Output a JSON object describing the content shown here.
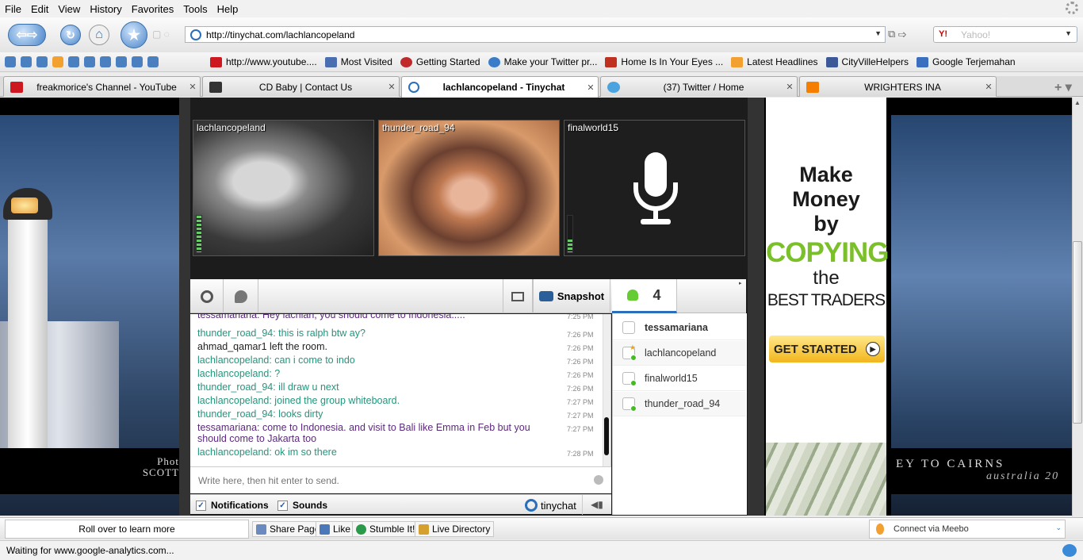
{
  "menu": [
    "File",
    "Edit",
    "View",
    "History",
    "Favorites",
    "Tools",
    "Help"
  ],
  "address": {
    "url": "http://tinychat.com/lachlancopeland",
    "search_placeholder": "Yahoo!"
  },
  "bookmarks": [
    {
      "label": "http://www.youtube....",
      "color": "#cc181e"
    },
    {
      "label": "Most Visited",
      "color": "#4a6fb0"
    },
    {
      "label": "Getting Started",
      "color": "#c0282a"
    },
    {
      "label": "Make your Twitter pr...",
      "color": "#3b7cc8"
    },
    {
      "label": "Home Is In Your Eyes ...",
      "color": "#c03020"
    },
    {
      "label": "Latest Headlines",
      "color": "#f2a030"
    },
    {
      "label": "CityVilleHelpers",
      "color": "#3b5998"
    },
    {
      "label": "Google Terjemahan",
      "color": "#3a6fc0"
    }
  ],
  "tabs": [
    {
      "label": "freakmorice's Channel - YouTube",
      "icon": "youtube-icon",
      "color": "#cc181e"
    },
    {
      "label": "CD Baby | Contact Us",
      "icon": "cdbaby-icon",
      "color": "#333333"
    },
    {
      "label": "lachlancopeland - Tinychat",
      "icon": "tinychat-icon",
      "color": "#2a6fba"
    },
    {
      "label": "(37) Twitter / Home",
      "icon": "twitter-icon",
      "color": "#4aa3df"
    },
    {
      "label": "WRIGHTERS INA",
      "icon": "blogger-icon",
      "color": "#f57d00"
    }
  ],
  "videos": [
    {
      "name": "lachlancopeland"
    },
    {
      "name": "thunder_road_94"
    },
    {
      "name": "finalworld15"
    }
  ],
  "toolbar": {
    "snapshot_label": "Snapshot",
    "user_count": "4"
  },
  "messages": [
    {
      "text": "tessamariana: Hey lachlan, you should come to Indonesia.....",
      "time": "7:25 PM",
      "color": "purple"
    },
    {
      "text": "thunder_road_94: this is ralph btw ay?",
      "time": "7:26 PM",
      "color": "green"
    },
    {
      "text": "ahmad_qamar1 left the room.",
      "time": "7:26 PM",
      "color": "black"
    },
    {
      "text": "lachlancopeland: can i come to indo",
      "time": "7:26 PM",
      "color": "green"
    },
    {
      "text": "lachlancopeland: ?",
      "time": "7:26 PM",
      "color": "green"
    },
    {
      "text": "thunder_road_94: ill draw u next",
      "time": "7:26 PM",
      "color": "green"
    },
    {
      "text": "lachlancopeland: joined the group whiteboard.",
      "time": "7:27 PM",
      "color": "green"
    },
    {
      "text": "thunder_road_94: looks dirty",
      "time": "7:27 PM",
      "color": "green"
    },
    {
      "text": "tessamariana: come to Indonesia. and visit to Bali like Emma in Feb but you should come to Jakarta too",
      "time": "7:27 PM",
      "color": "purple"
    },
    {
      "text": "lachlancopeland: ok im so there",
      "time": "7:28 PM",
      "color": "green"
    }
  ],
  "chat_input": {
    "placeholder": "Write here, then hit enter to send."
  },
  "chat_footer": {
    "notifications": "Notifications",
    "sounds": "Sounds",
    "brand": "tinychat"
  },
  "users": [
    {
      "name": "tessamariana",
      "status": "none"
    },
    {
      "name": "lachlancopeland",
      "status": "owner"
    },
    {
      "name": "finalworld15",
      "status": "online"
    },
    {
      "name": "thunder_road_94",
      "status": "online"
    }
  ],
  "ad": {
    "line1": "Make",
    "line2": "Money",
    "line3": "by",
    "copying": "COPYING",
    "the": "the",
    "best_traders": "BEST TRADERS",
    "cta": "GET STARTED"
  },
  "background_captions": {
    "left_1": "Phot",
    "left_2": "SCOTT",
    "right_1": "EY TO CAIRNS",
    "right_2": "australia 20"
  },
  "addon_bar": {
    "rollover": "Roll over to learn more",
    "share": "Share Page",
    "like": "Like",
    "stumble": "Stumble It!",
    "live_directory": "Live Directory",
    "meebo": "Connect via Meebo"
  },
  "status": "Waiting for www.google-analytics.com..."
}
